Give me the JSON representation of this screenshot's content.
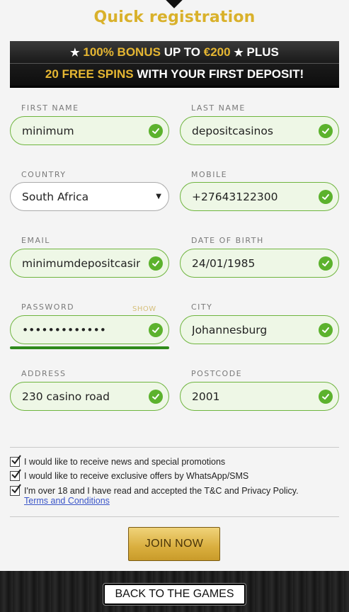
{
  "title": "Quick registration",
  "banner": {
    "star": "★",
    "line1_bonus": "100% BONUS",
    "line1_mid": " UP TO ",
    "line1_amount": "€200",
    "line1_end": " PLUS",
    "line2_spins": "20 FREE SPINS",
    "line2_rest": " WITH YOUR FIRST DEPOSIT!"
  },
  "fields": {
    "first_name": {
      "label": "FIRST NAME",
      "value": "minimum"
    },
    "last_name": {
      "label": "LAST NAME",
      "value": "depositcasinos"
    },
    "country": {
      "label": "COUNTRY",
      "value": "South Africa"
    },
    "mobile": {
      "label": "MOBILE",
      "value": "+27643122300"
    },
    "email": {
      "label": "EMAIL",
      "value": "minimumdepositcasinos"
    },
    "dob": {
      "label": "DATE OF BIRTH",
      "value": "24/01/1985"
    },
    "password": {
      "label": "PASSWORD",
      "value": "•••••••••••••",
      "show": "SHOW"
    },
    "city": {
      "label": "CITY",
      "value": "Johannesburg"
    },
    "address": {
      "label": "ADDRESS",
      "value": "230 casino road"
    },
    "postcode": {
      "label": "POSTCODE",
      "value": "2001"
    }
  },
  "consents": [
    {
      "text": "I would like to receive news and special promotions",
      "checked": true
    },
    {
      "text": "I would like to receive exclusive offers by WhatsApp/SMS",
      "checked": true
    },
    {
      "text": "I'm over 18 and I have read and accepted the T&C and Privacy Policy.",
      "checked": true
    }
  ],
  "terms_link": "Terms and Conditions",
  "join_button": "JOIN NOW",
  "back_button": "BACK TO THE GAMES",
  "colors": {
    "accent_gold": "#d9b12b",
    "valid_green": "#5cb22d",
    "link_blue": "#3a55c8"
  }
}
